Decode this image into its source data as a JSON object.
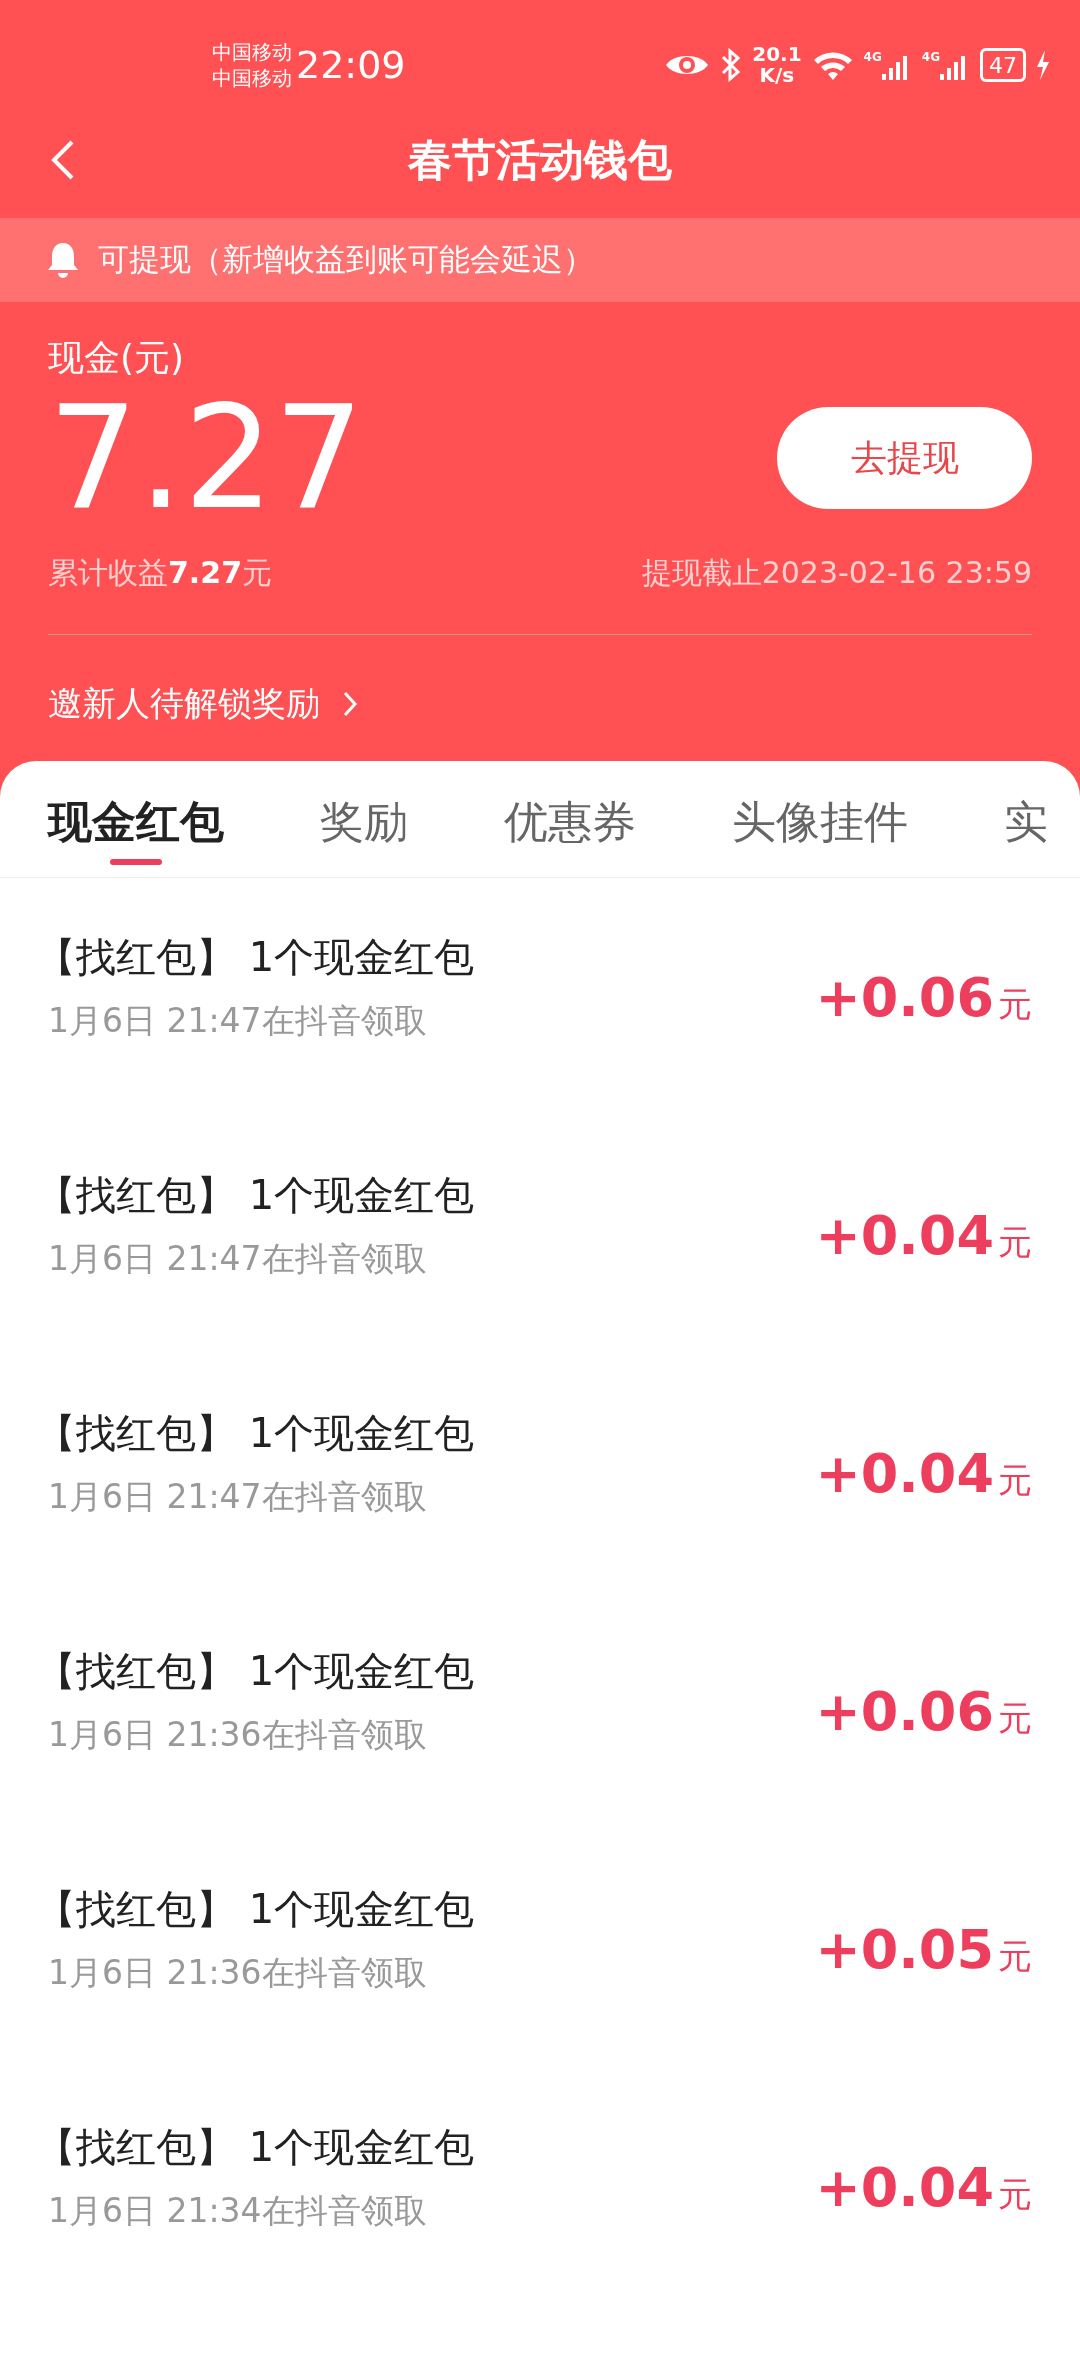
{
  "status_bar": {
    "carriers": [
      "中国移动",
      "中国移动"
    ],
    "time": "22:09",
    "speed": [
      "20.1",
      "K/s"
    ],
    "signals": [
      {
        "network": "4G"
      },
      {
        "network": "4G"
      }
    ],
    "battery": "47"
  },
  "header": {
    "title": "春节活动钱包"
  },
  "notice": {
    "text": "可提现（新增收益到账可能会延迟）"
  },
  "wallet": {
    "label": "现金(元)",
    "amount": "7.27",
    "button": "去提现",
    "total": "累计收益**7.27**元",
    "deadline": "提现截止2023-02-16 23:59",
    "invite": "邀新人待解锁奖励"
  },
  "tabs": [
    {
      "label": "现金红包",
      "selected": true
    },
    {
      "label": "奖励",
      "selected": false
    },
    {
      "label": "优惠券",
      "selected": false
    },
    {
      "label": "头像挂件",
      "selected": false
    },
    {
      "label": "实",
      "selected": false
    }
  ],
  "records": [
    {
      "title": "【找红包】 1个现金红包",
      "time": "1月6日 21:47在抖音领取",
      "amount": "+0.06",
      "unit": "元"
    },
    {
      "title": "【找红包】 1个现金红包",
      "time": "1月6日 21:47在抖音领取",
      "amount": "+0.04",
      "unit": "元"
    },
    {
      "title": "【找红包】 1个现金红包",
      "time": "1月6日 21:47在抖音领取",
      "amount": "+0.04",
      "unit": "元"
    },
    {
      "title": "【找红包】 1个现金红包",
      "time": "1月6日 21:36在抖音领取",
      "amount": "+0.06",
      "unit": "元"
    },
    {
      "title": "【找红包】 1个现金红包",
      "time": "1月6日 21:36在抖音领取",
      "amount": "+0.05",
      "unit": "元"
    },
    {
      "title": "【找红包】 1个现金红包",
      "time": "1月6日 21:34在抖音领取",
      "amount": "+0.04",
      "unit": "元"
    }
  ]
}
